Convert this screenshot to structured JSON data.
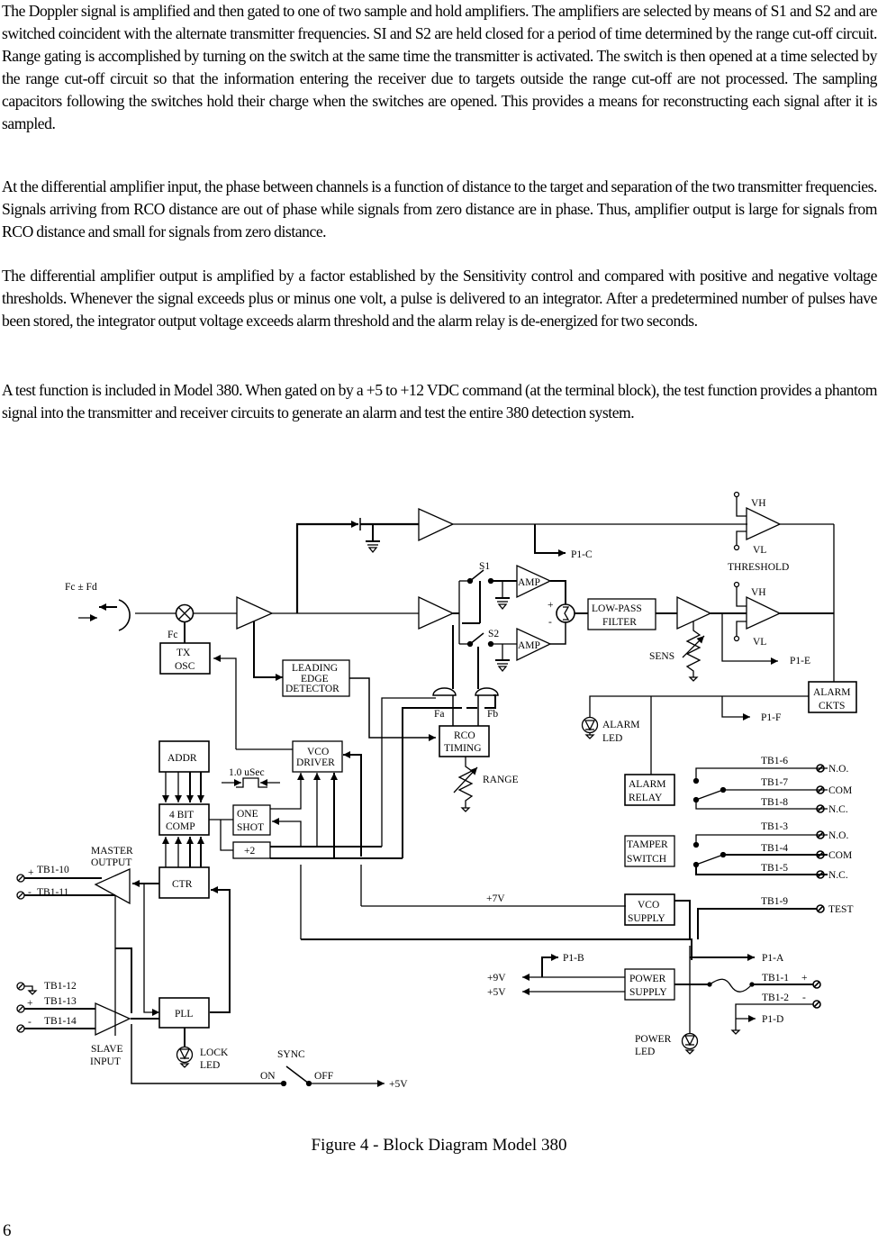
{
  "paragraphs": [
    "The Doppler signal is amplified and then gated to one of two sample and hold amplifiers. The amplifiers are selected by means of S1 and S2 and are switched coincident with the alternate transmitter frequencies. SI and S2 are held closed for a period of time determined by the range cut-off circuit. Range gating is accomplished by turning on the switch at the same time the transmitter is activated. The switch is then opened at a time selected by the range cut-off circuit so that the information entering the receiver due to targets outside the range cut-off are not processed. The sampling capacitors following the switches hold their charge when the switches are opened. This provides a means for reconstructing each signal after it is sampled.",
    "At the differential amplifier input, the phase between channels is a function of distance to the target and separation of the two transmitter frequencies.  Signals arriving from RCO distance are out of phase while signals from zero distance are in phase. Thus, amplifier output is large for signals from RCO distance and small for signals from zero distance.",
    "The differential amplifier output is amplified by a factor established by the Sensitivity control and compared with positive and negative voltage thresholds. Whenever the signal exceeds plus or minus one volt, a pulse is delivered to an integrator. After a predetermined number of pulses have been stored, the integrator output voltage exceeds alarm threshold and the alarm relay is de-energized for two seconds.",
    "A test function is included in Model 380. When gated on by a +5 to +12 VDC command (at the terminal block), the test function provides a phantom signal into the transmitter and receiver circuits to generate an alarm and test the entire 380 detection system."
  ],
  "diagram": {
    "blocks": {
      "tx_osc": [
        "TX",
        "OSC"
      ],
      "leading_edge": [
        "LEADING",
        "EDGE",
        "DETECTOR"
      ],
      "vco_driver": [
        "VCO",
        "DRIVER"
      ],
      "rco_timing": [
        "RCO",
        "TIMING"
      ],
      "low_pass": [
        "LOW-PASS",
        "FILTER"
      ],
      "alarm_ckts": [
        "ALARM",
        "CKTS"
      ],
      "addr": "ADDR",
      "comp": [
        "4 BIT",
        "COMP"
      ],
      "one_shot": [
        "ONE",
        "SHOT"
      ],
      "div2": "+2",
      "ctr": "CTR",
      "pll": "PLL",
      "alarm_relay": [
        "ALARM",
        "RELAY"
      ],
      "tamper_switch": [
        "TAMPER",
        "SWITCH"
      ],
      "vco_supply": [
        "VCO",
        "SUPPLY"
      ],
      "power_supply": [
        "POWER",
        "SUPPLY"
      ],
      "amp1": "AMP",
      "amp2": "AMP"
    },
    "labels": {
      "fc_fd": "Fc   ±   Fd",
      "fc": "Fc",
      "s1": "S1",
      "s2": "S2",
      "plus": "+",
      "minus": "-",
      "p1c": "P1-C",
      "p1e": "P1-E",
      "p1f": "P1-F",
      "p1a": "P1-A",
      "p1b": "P1-B",
      "p1d": "P1-D",
      "vh1": "VH",
      "vl1": "VL",
      "vh2": "VH",
      "vl2": "VL",
      "threshold": "THRESHOLD",
      "sens": "SENS",
      "fa": "Fa",
      "fb": "Fb",
      "range": "RANGE",
      "alarm_led": [
        "ALARM",
        "LED"
      ],
      "pulse_width": "1.0 uSec",
      "master_output": [
        "MASTER",
        "OUTPUT"
      ],
      "slave_input": [
        "SLAVE",
        "INPUT"
      ],
      "lock_led": [
        "LOCK",
        "LED"
      ],
      "power_led": [
        "POWER",
        "LED"
      ],
      "sync": "SYNC",
      "on": "ON",
      "off": "OFF",
      "plus5v_sync": "+5V",
      "plus7v": "+7V",
      "plus9v": "+9V",
      "plus5v": "+5V"
    },
    "terminals": {
      "tb1_10": "TB1-10",
      "tb1_11": "TB1-11",
      "tb1_12": "TB1-12",
      "tb1_13": "TB1-13",
      "tb1_14": "TB1-14",
      "tb1_6": "TB1-6",
      "tb1_7": "TB1-7",
      "tb1_8": "TB1-8",
      "tb1_3": "TB1-3",
      "tb1_4": "TB1-4",
      "tb1_5": "TB1-5",
      "tb1_9": "TB1-9",
      "tb1_1": "TB1-1",
      "tb1_2": "TB1-2",
      "no": "N.O.",
      "com": "COM",
      "nc": "N.C.",
      "test": "TEST"
    }
  },
  "caption": "Figure 4 - Block Diagram Model 380",
  "page_number": "6"
}
